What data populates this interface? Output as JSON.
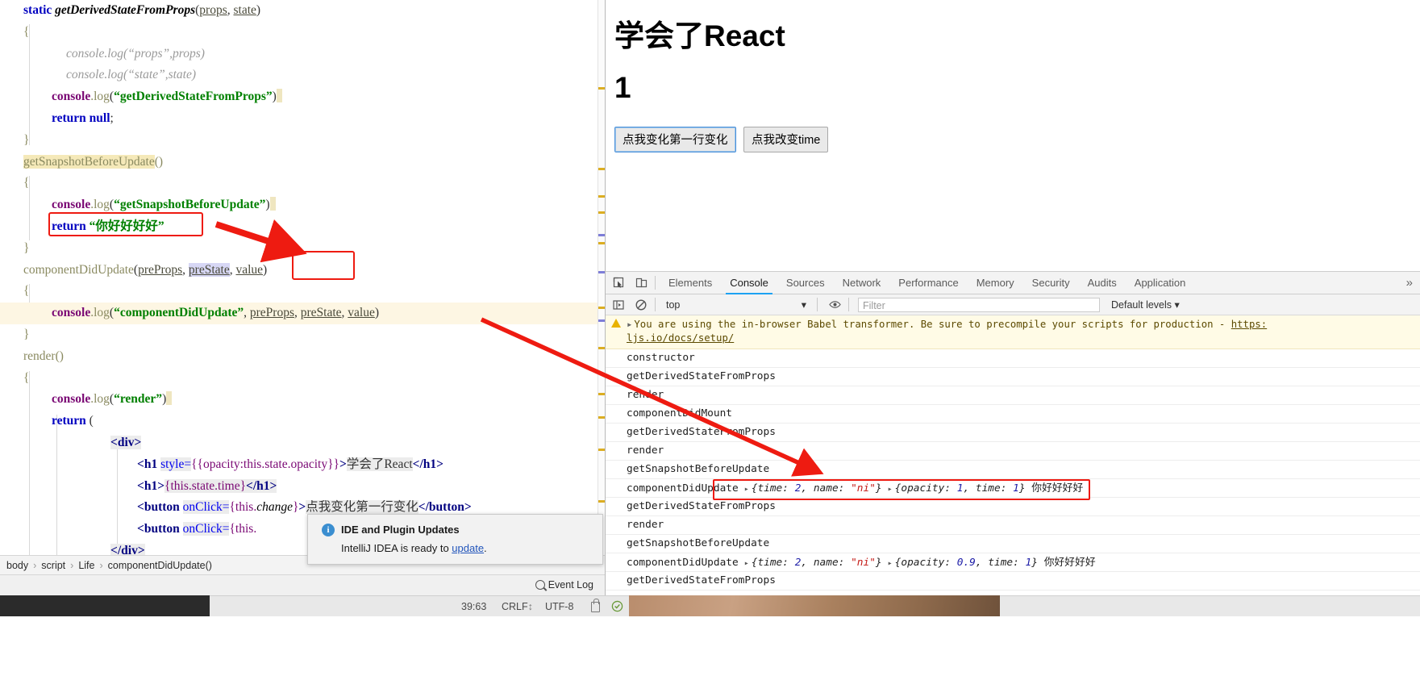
{
  "ide": {
    "code_lines": [
      "static getDerivedStateFromProps(props, state)",
      "{",
      "console.log(\"props\",props)",
      "console.log(\"state\",state)",
      "console.log(\"getDerivedStateFromProps\")",
      "return null;",
      "}",
      "getSnapshotBeforeUpdate()",
      "{",
      "console.log(\"getSnapshotBeforeUpdate\")",
      "return \"你好好好好\"",
      "}",
      "componentDidUpdate(preProps, preState, value)",
      "{",
      "console.log(\"componentDidUpdate\",preProps,preState,value)",
      "}",
      "render()",
      "{",
      "console.log(\"render\")",
      "return (",
      "<div>",
      "<h1 style={{opacity:this.state.opacity}}>学会了React</h1>",
      "<h1>{this.state.time}</h1>",
      "<button onClick={this.change}>点我变化第一行变化</button>",
      "<button onClick={this.",
      "</div>"
    ],
    "tokens": {
      "static": "static",
      "fn_gdsfp": "getDerivedStateFromProps",
      "props": "props",
      "state": "state",
      "console": "console",
      "log": "log",
      "str_props": "\"props\"",
      "str_state": "\"state\"",
      "str_gdsfp": "\"getDerivedStateFromProps\"",
      "return": "return",
      "null": "null",
      "fn_gsbu": "getSnapshotBeforeUpdate",
      "str_gsbu": "\"getSnapshotBeforeUpdate\"",
      "str_nihao": "\"你好好好好\"",
      "fn_cdu": "componentDidUpdate",
      "preProps": "preProps",
      "preState": "preState",
      "value": "value",
      "str_cdu": "\"componentDidUpdate\"",
      "fn_render": "render",
      "str_render": "\"render\"",
      "tag_div_open": "<div>",
      "tag_div_close": "</div>",
      "tag_h1_open": "<h1",
      "attr_style": "style=",
      "style_expr": "{{opacity:this.state.opacity}}",
      "gt": ">",
      "h1_text": "学会了React",
      "tag_h1_end": "</h1>",
      "h1_time_open": "<h1>",
      "time_expr": "{this.state.time}",
      "tag_btn_open": "<button",
      "attr_onclick": "onClick=",
      "change_expr": "{this.change}",
      "btn_text": "点我变化第一行变化",
      "tag_btn_end": "</button>",
      "change_expr2": "{this."
    },
    "breadcrumb": [
      "body",
      "script",
      "Life",
      "componentDidUpdate()"
    ],
    "event_log_label": "Event Log",
    "popup": {
      "title": "IDE and Plugin Updates",
      "body_before": "IntelliJ IDEA is ready to ",
      "link": "update",
      "body_after": "."
    }
  },
  "statusbar": {
    "caret": "39:63",
    "line_sep": "CRLF",
    "encoding": "UTF-8"
  },
  "page": {
    "heading": "学会了React",
    "time_value": "1",
    "buttons": [
      {
        "label": "点我变化第一行变化",
        "focused": true
      },
      {
        "label": "点我改变time",
        "focused": false
      }
    ]
  },
  "devtools": {
    "tabs": [
      "Elements",
      "Console",
      "Sources",
      "Network",
      "Performance",
      "Memory",
      "Security",
      "Audits",
      "Application"
    ],
    "active_tab": "Console",
    "more_glyph": "»",
    "filterbar": {
      "context": "top",
      "filter_placeholder": "Filter",
      "levels": "Default levels",
      "levels_caret": "▾",
      "context_caret": "▾"
    },
    "warning": {
      "text": "You are using the in-browser Babel transformer. Be sure to precompile your scripts for production -",
      "link": "https:",
      "link2": "ljs.io/docs/setup/"
    },
    "logs": [
      {
        "text": "constructor"
      },
      {
        "text": "getDerivedStateFromProps"
      },
      {
        "text": "render"
      },
      {
        "text": "componentDidMount"
      },
      {
        "text": "getDerivedStateFromProps"
      },
      {
        "text": "render"
      },
      {
        "text": "getSnapshotBeforeUpdate"
      },
      {
        "text": "componentDidUpdate",
        "highlighted": true,
        "obj1": {
          "time": "2",
          "name": "\"ni\""
        },
        "obj2": {
          "opacity": "1",
          "time": "1"
        },
        "suffix": "你好好好好"
      },
      {
        "text": "getDerivedStateFromProps"
      },
      {
        "text": "render"
      },
      {
        "text": "getSnapshotBeforeUpdate"
      },
      {
        "text": "componentDidUpdate",
        "obj1": {
          "time": "2",
          "name": "\"ni\""
        },
        "obj2": {
          "opacity": "0.9",
          "time": "1"
        },
        "suffix": "你好好好好"
      },
      {
        "text": "getDerivedStateFromProps"
      }
    ]
  },
  "colors": {
    "annotation_red": "#ee1b11",
    "accent_blue": "#1da2f2",
    "warn_bg": "#fffbe6"
  }
}
